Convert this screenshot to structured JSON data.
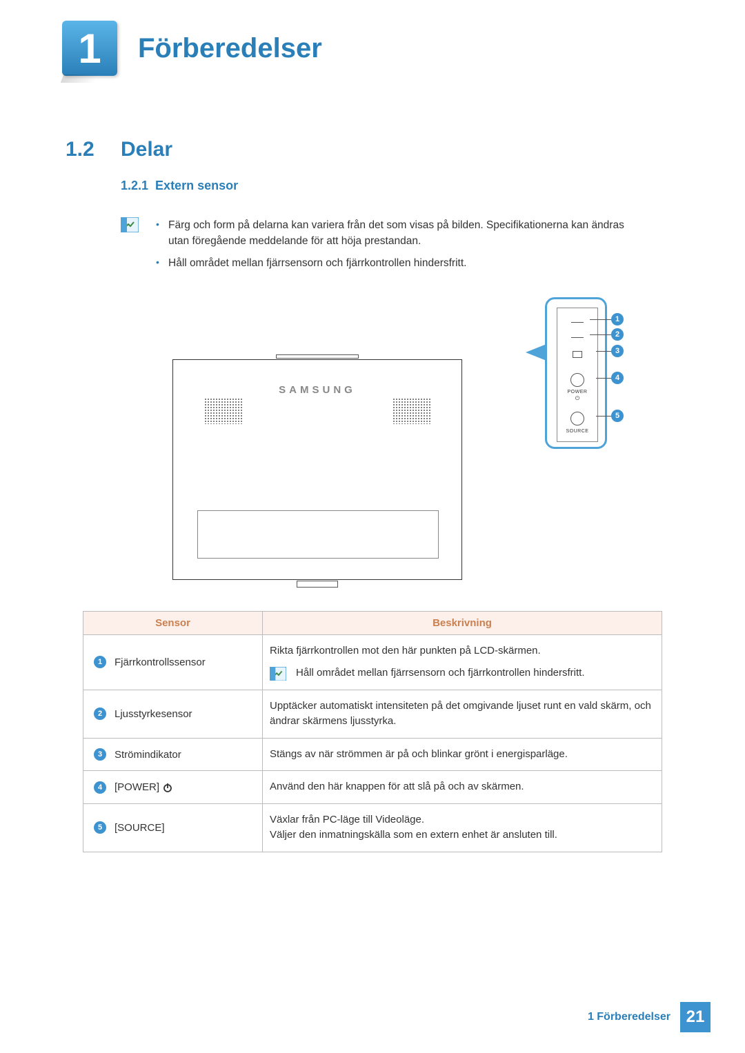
{
  "chapter": {
    "number": "1",
    "title": "Förberedelser"
  },
  "section": {
    "number": "1.2",
    "title": "Delar"
  },
  "subsection": {
    "number": "1.2.1",
    "title": "Extern sensor"
  },
  "notes": [
    "Färg och form på delarna kan variera från det som visas på bilden. Specifikationerna kan ändras utan föregående meddelande för att höja prestandan.",
    "Håll området mellan fjärrsensorn och fjärrkontrollen hindersfritt."
  ],
  "diagram": {
    "brand": "SAMSUNG",
    "callout_labels": {
      "power": "POWER",
      "source": "SOURCE"
    },
    "badges": [
      "1",
      "2",
      "3",
      "4",
      "5"
    ]
  },
  "table": {
    "headers": {
      "sensor": "Sensor",
      "description": "Beskrivning"
    },
    "rows": [
      {
        "num": "1",
        "sensor": "Fjärrkontrollssensor",
        "desc": "Rikta fjärrkontrollen mot den här punkten på LCD-skärmen.",
        "note": "Håll området mellan fjärrsensorn och fjärrkontrollen hindersfritt."
      },
      {
        "num": "2",
        "sensor": "Ljusstyrkesensor",
        "desc": "Upptäcker automatiskt intensiteten på det omgivande ljuset runt en vald skärm, och ändrar skärmens ljusstyrka."
      },
      {
        "num": "3",
        "sensor": "Strömindikator",
        "desc": "Stängs av när strömmen är på och blinkar grönt i energisparläge."
      },
      {
        "num": "4",
        "sensor": "[POWER]",
        "has_power_icon": true,
        "desc": "Använd den här knappen för att slå på och av skärmen."
      },
      {
        "num": "5",
        "sensor": "[SOURCE]",
        "desc": "Växlar från PC-läge till Videoläge.",
        "desc2": "Väljer den inmatningskälla som en extern enhet är ansluten till."
      }
    ]
  },
  "footer": {
    "text": "1 Förberedelser",
    "page": "21"
  }
}
